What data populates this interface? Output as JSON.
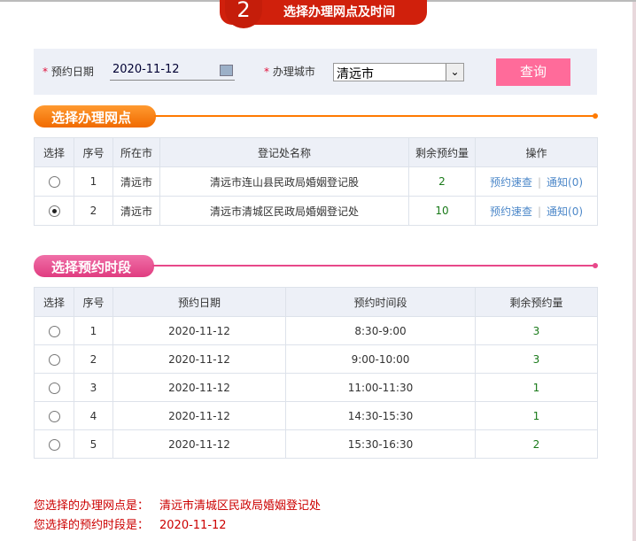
{
  "step": {
    "number": "2",
    "title": "选择办理网点及时间"
  },
  "form": {
    "date_label": "预约日期",
    "date_value": "2020-11-12",
    "city_label": "办理城市",
    "city_value": "清远市",
    "query_button": "查询",
    "required_mark": "*"
  },
  "section1": {
    "title": "选择办理网点",
    "color": "#ff7a00",
    "headers": [
      "选择",
      "序号",
      "所在市",
      "登记处名称",
      "剩余预约量",
      "操作"
    ],
    "rows": [
      {
        "selected": false,
        "no": "1",
        "city": "清远市",
        "name": "清远市连山县民政局婚姻登记股",
        "remaining": "2",
        "action1": "预约速查",
        "action2": "通知(0)"
      },
      {
        "selected": true,
        "no": "2",
        "city": "清远市",
        "name": "清远市清城区民政局婚姻登记处",
        "remaining": "10",
        "action1": "预约速查",
        "action2": "通知(0)"
      }
    ]
  },
  "section2": {
    "title": "选择预约时段",
    "color": "#e8488a",
    "headers": [
      "选择",
      "序号",
      "预约日期",
      "预约时间段",
      "剩余预约量"
    ],
    "rows": [
      {
        "selected": false,
        "no": "1",
        "date": "2020-11-12",
        "time": "8:30-9:00",
        "remaining": "3"
      },
      {
        "selected": false,
        "no": "2",
        "date": "2020-11-12",
        "time": "9:00-10:00",
        "remaining": "3"
      },
      {
        "selected": false,
        "no": "3",
        "date": "2020-11-12",
        "time": "11:00-11:30",
        "remaining": "1"
      },
      {
        "selected": false,
        "no": "4",
        "date": "2020-11-12",
        "time": "14:30-15:30",
        "remaining": "1"
      },
      {
        "selected": false,
        "no": "5",
        "date": "2020-11-12",
        "time": "15:30-16:30",
        "remaining": "2"
      }
    ]
  },
  "result": {
    "office_label": "您选择的办理网点是：",
    "office_value": "清远市清城区民政局婚姻登记处",
    "slot_label": "您选择的预约时段是：",
    "slot_value": "2020-11-12"
  }
}
